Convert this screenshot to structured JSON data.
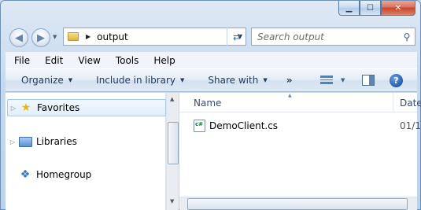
{
  "window": {
    "caption_buttons": [
      {
        "name": "minimize",
        "glyph": "▁"
      },
      {
        "name": "maximize",
        "glyph": "☐"
      },
      {
        "name": "close",
        "glyph": "✕"
      }
    ]
  },
  "address_bar": {
    "icon": "folder-icon",
    "path": "output",
    "search_placeholder": "Search output"
  },
  "menu": {
    "items": [
      "File",
      "Edit",
      "View",
      "Tools",
      "Help"
    ]
  },
  "toolbar": {
    "organize": "Organize",
    "include_in_library": "Include in library",
    "share_with": "Share with",
    "more": "»"
  },
  "nav_pane": {
    "items": [
      {
        "label": "Favorites",
        "icon": "star-icon",
        "selected": true
      },
      {
        "label": "Libraries",
        "icon": "library-icon",
        "selected": false
      },
      {
        "label": "Homegroup",
        "icon": "homegroup-icon",
        "selected": false
      }
    ]
  },
  "file_list": {
    "columns": [
      "Name",
      "Date"
    ],
    "files": [
      {
        "name": "DemoClient.cs",
        "date": "01/1",
        "icon": "csharp-file-icon"
      }
    ]
  },
  "colors": {
    "accent": "#1e395b",
    "selection": "#e1eefb"
  }
}
